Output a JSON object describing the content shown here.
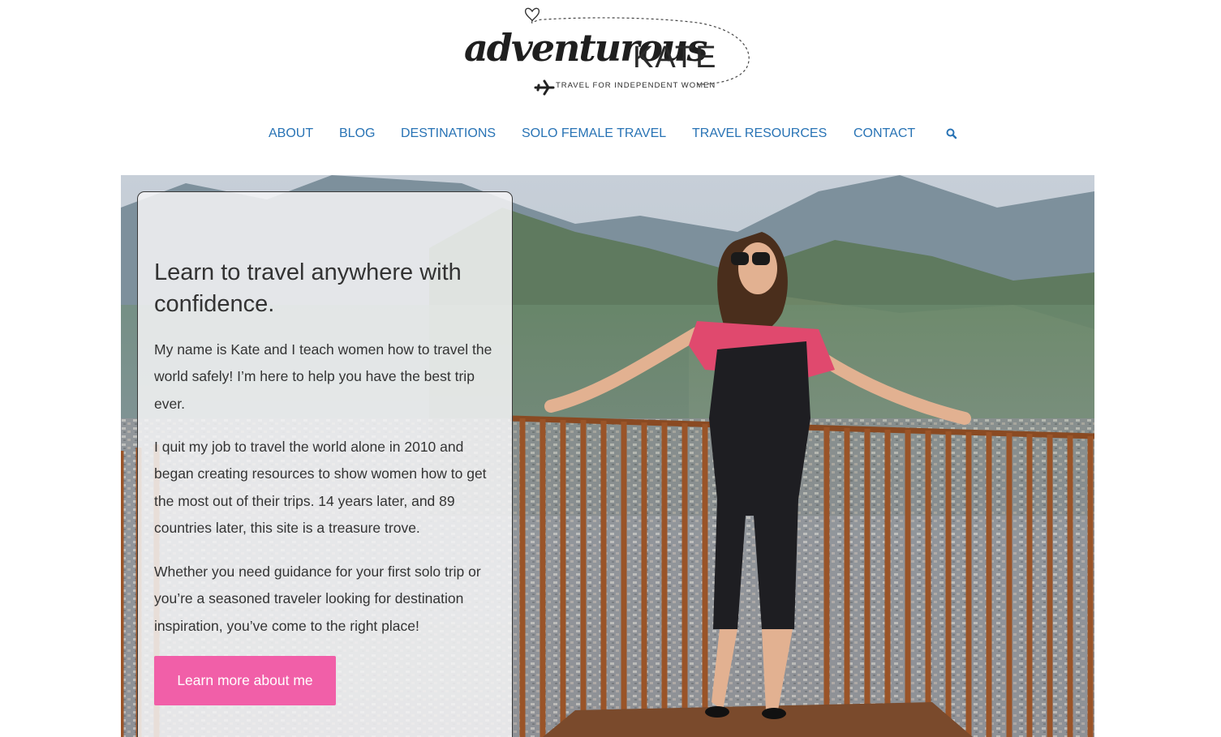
{
  "logo": {
    "script_text": "adventurous",
    "name_text": "KATE",
    "tagline": "TRAVEL FOR INDEPENDENT WOMEN"
  },
  "nav": {
    "items": [
      {
        "label": "ABOUT"
      },
      {
        "label": "BLOG"
      },
      {
        "label": "DESTINATIONS"
      },
      {
        "label": "SOLO FEMALE TRAVEL"
      },
      {
        "label": "TRAVEL RESOURCES"
      },
      {
        "label": "CONTACT"
      }
    ],
    "search_icon": "search-icon"
  },
  "hero": {
    "title": "Learn to travel anywhere with confidence.",
    "paragraphs": [
      "My name is Kate and I teach women how to travel the world safely! I’m here to help you have the best trip ever.",
      "I quit my job to travel the world alone in 2010 and began creating resources to show women how to get the most out of their trips. 14 years later, and 89 countries later, this site is a treasure trove.",
      "Whether you need guidance for your first solo trip or you’re a seasoned traveler looking for destination inspiration, you’ve come to the right place!"
    ],
    "button_label": "Learn more about me"
  },
  "colors": {
    "nav_link": "#2873b5",
    "button_bg": "#f15fa8",
    "text": "#333333"
  }
}
